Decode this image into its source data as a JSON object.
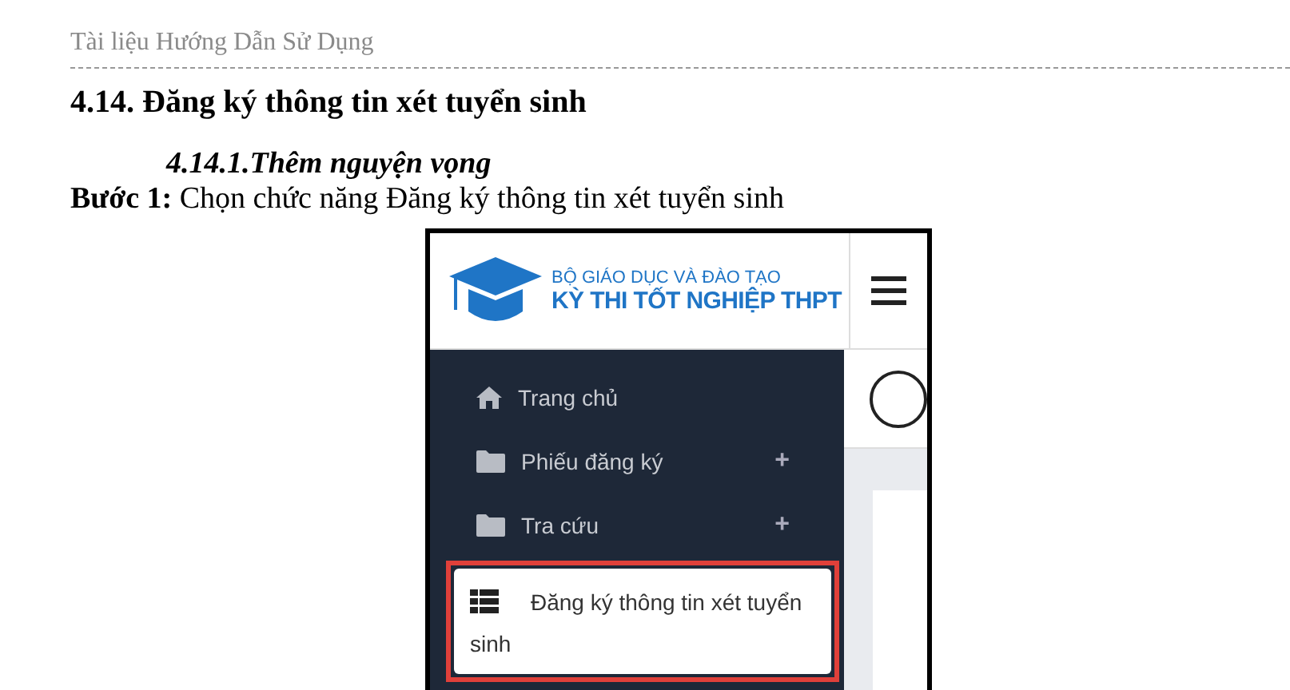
{
  "page_header": "Tài liệu Hướng Dẫn Sử Dụng",
  "heading": "4.14. Đăng ký thông tin xét tuyển sinh",
  "subheading": "4.14.1.Thêm nguyện vọng",
  "step": "**Bước 1:** Chọn chức năng Đăng ký thông tin xét tuyển sinh",
  "screenshot": {
    "logo": {
      "line_1": "BỘ GIÁO DỤC VÀ ĐÀO TẠO",
      "line_2": "KỲ THI TỐT NGHIỆP THPT"
    },
    "sidebar": {
      "items": [
        {
          "kind": "home",
          "label": "Trang chủ",
          "selected": false
        },
        {
          "kind": "folder",
          "label": "Phiếu đăng ký",
          "expander": "+",
          "selected": false
        },
        {
          "kind": "folder",
          "label": "Tra cứu",
          "expander": "+",
          "selected": false
        },
        {
          "kind": "list",
          "label": "Đăng ký thông tin xét tuyển sinh",
          "selected": true
        }
      ]
    }
  }
}
